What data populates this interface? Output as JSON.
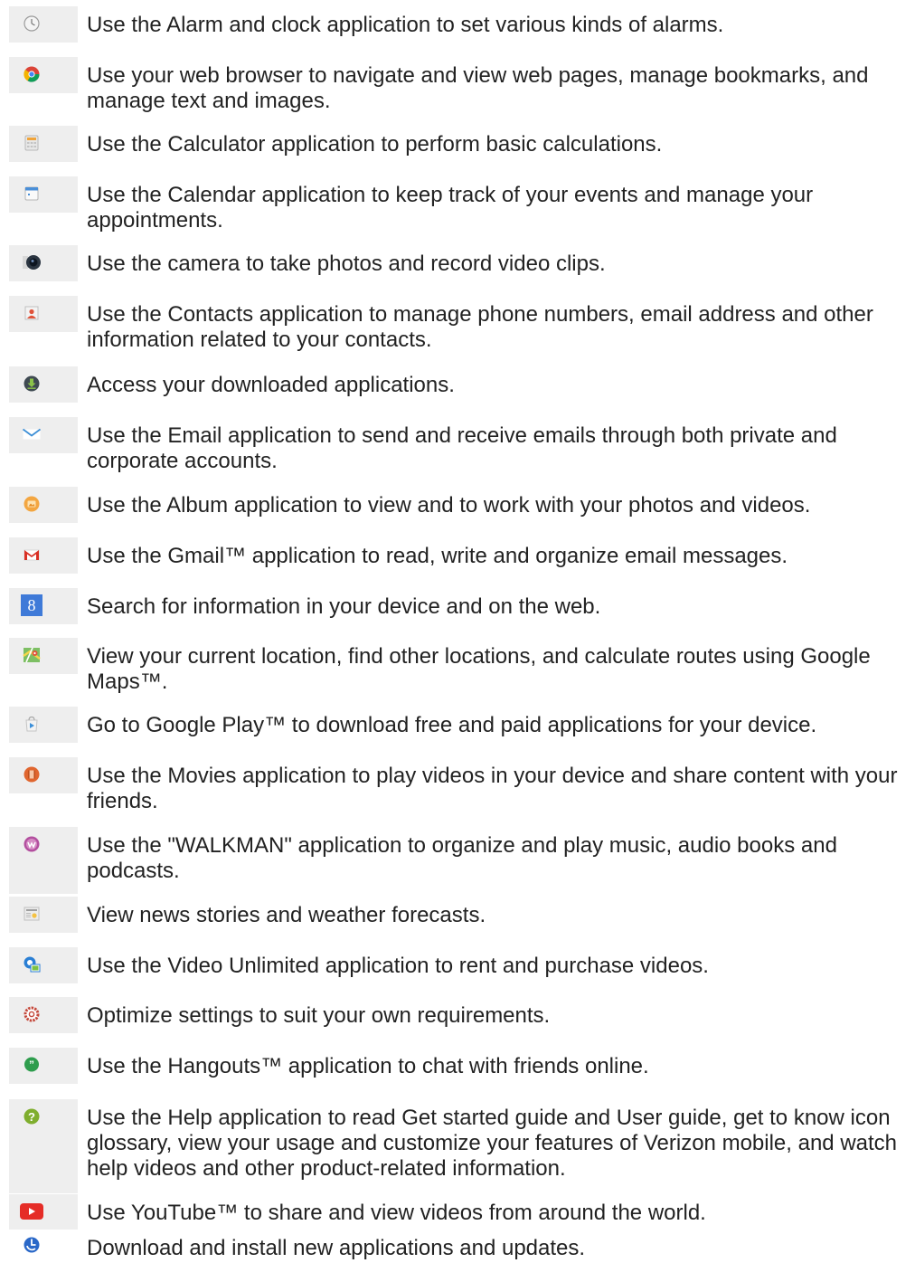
{
  "items": [
    {
      "icon": "alarm-clock-icon",
      "text": "Use the Alarm and clock application to set various kinds of alarms."
    },
    {
      "icon": "web-browser-icon",
      "text": "Use your web browser to navigate and view web pages, manage bookmarks, and manage text and images."
    },
    {
      "icon": "calculator-icon",
      "text": "Use the Calculator application to perform basic calculations."
    },
    {
      "icon": "calendar-icon",
      "text": "Use the Calendar application to keep track of your events and manage your appointments."
    },
    {
      "icon": "camera-icon",
      "text": "Use the camera to take photos and record video clips."
    },
    {
      "icon": "contacts-icon",
      "text": "Use the Contacts application to manage phone numbers, email address and other information related to your contacts."
    },
    {
      "icon": "downloads-icon",
      "text": "Access your downloaded applications."
    },
    {
      "icon": "email-icon",
      "text": "Use the Email application to send and receive emails through both private and corporate accounts."
    },
    {
      "icon": "album-icon",
      "text": "Use the Album application to view and to work with your photos and videos."
    },
    {
      "icon": "gmail-icon",
      "text": "Use the Gmail™ application to read, write and organize email messages."
    },
    {
      "icon": "google-search-icon",
      "text": "Search for information in your device and on the web."
    },
    {
      "icon": "maps-icon",
      "text": "View your current location, find other locations, and calculate routes using Google Maps™."
    },
    {
      "icon": "google-play-icon",
      "text": "Go to Google Play™ to download free and paid applications for your device."
    },
    {
      "icon": "movies-icon",
      "text": "Use the Movies application to play videos in your device and share content with your friends."
    },
    {
      "icon": "walkman-icon",
      "text": "Use the \"WALKMAN\" application to organize and play music, audio books and podcasts."
    },
    {
      "icon": "news-weather-icon",
      "text": "View news stories and weather forecasts."
    },
    {
      "icon": "video-unlimited-icon",
      "text": "Use the Video Unlimited application to rent and purchase videos."
    },
    {
      "icon": "settings-icon",
      "text": "Optimize settings to suit your own requirements."
    },
    {
      "icon": "hangouts-icon",
      "text": "Use the Hangouts™ application to chat with friends online."
    },
    {
      "icon": "help-icon",
      "text": "Use the Help application to read Get started guide and User guide, get to know icon glossary, view your usage and customize your features of Verizon mobile, and watch help videos and other product-related information."
    },
    {
      "icon": "youtube-icon",
      "text": "Use YouTube™ to share and view videos from around the world."
    },
    {
      "icon": "update-center-icon",
      "text": "Download and install new applications and updates."
    }
  ]
}
